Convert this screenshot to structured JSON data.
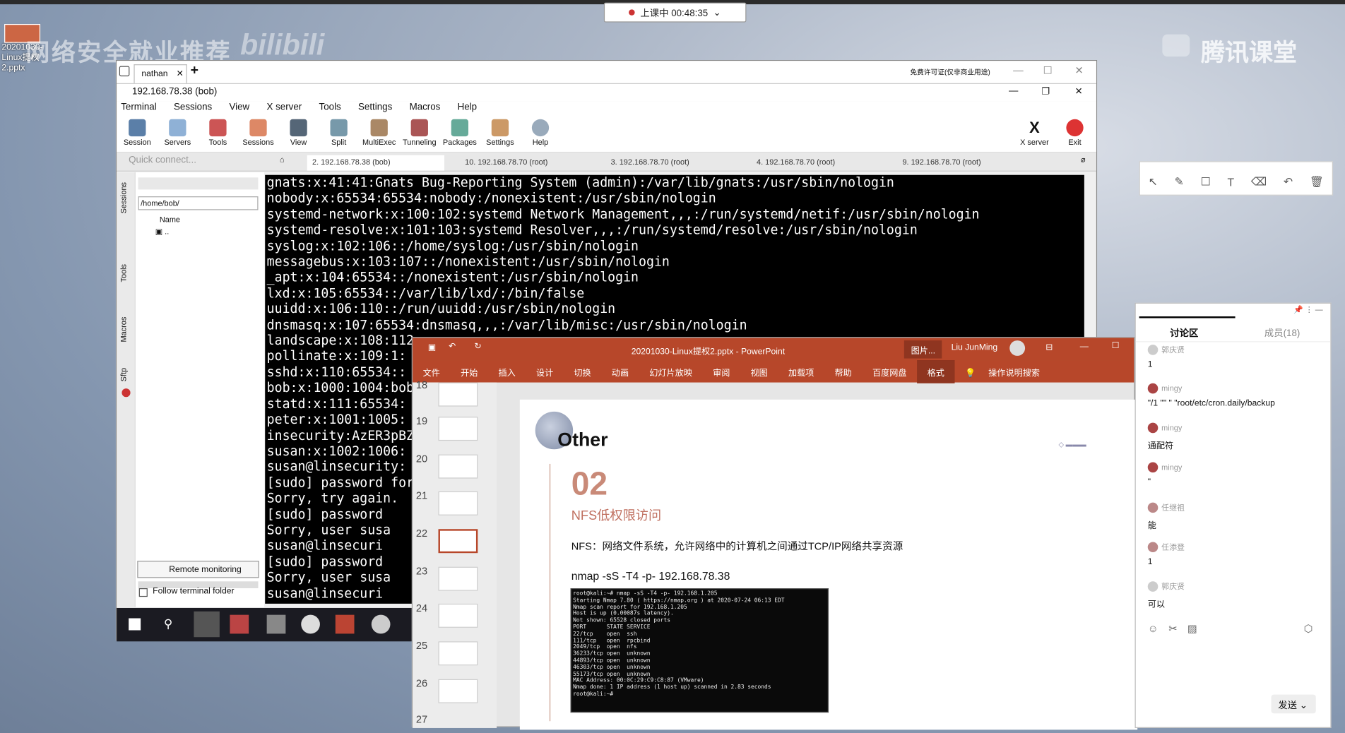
{
  "overlay": {
    "live_status": "上课中 00:48:35",
    "watermark": "网络安全就业推荐",
    "bilibili": "bilibili",
    "tencent": "腾讯课堂",
    "desktop_file": "20201030-Linux提权2.pptx"
  },
  "moba": {
    "tab_label": "nathan",
    "license_note": "免费许可证(仅非商业用途)",
    "window_title": "192.168.78.38 (bob)",
    "menu": [
      "Terminal",
      "Sessions",
      "View",
      "X server",
      "Tools",
      "Settings",
      "Macros",
      "Help"
    ],
    "toolbar": [
      "Session",
      "Servers",
      "Tools",
      "Sessions",
      "View",
      "Split",
      "MultiExec",
      "Tunneling",
      "Packages",
      "Settings",
      "Help",
      "X server",
      "Exit"
    ],
    "quick_connect": "Quick connect...",
    "session_tabs": [
      "2. 192.168.78.38 (bob)",
      "10. 192.168.78.70 (root)",
      "3. 192.168.78.70 (root)",
      "4. 192.168.78.70 (root)",
      "9. 192.168.78.70 (root)"
    ],
    "path": "/home/bob/",
    "tree_header": "Name",
    "tree_item": "..",
    "side_tabs": [
      "Sessions",
      "Tools",
      "Macros",
      "Sftp"
    ],
    "remote_monitoring": "Remote monitoring",
    "follow_terminal": "Follow terminal folder",
    "terminal_lines": [
      "gnats:x:41:41:Gnats Bug-Reporting System (admin):/var/lib/gnats:/usr/sbin/nologin",
      "nobody:x:65534:65534:nobody:/nonexistent:/usr/sbin/nologin",
      "systemd-network:x:100:102:systemd Network Management,,,:/run/systemd/netif:/usr/sbin/nologin",
      "systemd-resolve:x:101:103:systemd Resolver,,,:/run/systemd/resolve:/usr/sbin/nologin",
      "syslog:x:102:106::/home/syslog:/usr/sbin/nologin",
      "messagebus:x:103:107::/nonexistent:/usr/sbin/nologin",
      "_apt:x:104:65534::/nonexistent:/usr/sbin/nologin",
      "lxd:x:105:65534::/var/lib/lxd/:/bin/false",
      "uuidd:x:106:110::/run/uuidd:/usr/sbin/nologin",
      "dnsmasq:x:107:65534:dnsmasq,,,:/var/lib/misc:/usr/sbin/nologin",
      "landscape:x:108:112",
      "pollinate:x:109:1:",
      "sshd:x:110:65534::",
      "bob:x:1000:1004:bob",
      "statd:x:111:65534:",
      "peter:x:1001:1005:",
      "insecurity:AzER3pBZ",
      "susan:x:1002:1006:",
      "susan@linsecurity:",
      "[sudo] password for",
      "Sorry, try again.",
      "[sudo] password",
      "Sorry, user susa",
      "susan@linsecuri",
      "[sudo] password",
      "Sorry, user susa",
      "susan@linsecuri"
    ]
  },
  "ppt": {
    "title": "20201030-Linux提权2.pptx - PowerPoint",
    "search_label": "图片...",
    "user": "Liu JunMing",
    "tabs": [
      "文件",
      "开始",
      "插入",
      "设计",
      "切换",
      "动画",
      "幻灯片放映",
      "审阅",
      "视图",
      "加载项",
      "帮助",
      "百度网盘",
      "格式",
      "操作说明搜索"
    ],
    "slide_numbers": [
      "18",
      "19",
      "20",
      "21",
      "22",
      "23",
      "24",
      "25",
      "26",
      "27"
    ],
    "slide": {
      "heading": "Other",
      "number": "02",
      "subtitle": "NFS低权限访问",
      "desc": "NFS：网络文件系统，允许网络中的计算机之间通过TCP/IP网络共享资源",
      "command": "nmap -sS -T4 -p- 192.168.78.38",
      "nmap_lines": [
        "root@kali:~# nmap -sS -T4 -p- 192.168.1.205",
        "Starting Nmap 7.80 ( https://nmap.org ) at 2020-07-24 06:13 EDT",
        "Nmap scan report for 192.168.1.205",
        "Host is up (0.00087s latency).",
        "Not shown: 65528 closed ports",
        "PORT      STATE SERVICE",
        "22/tcp    open  ssh",
        "111/tcp   open  rpcbind",
        "2049/tcp  open  nfs",
        "36233/tcp open  unknown",
        "44893/tcp open  unknown",
        "46303/tcp open  unknown",
        "55173/tcp open  unknown",
        "MAC Address: 00:0C:29:C9:C8:87 (VMware)",
        "",
        "Nmap done: 1 IP address (1 host up) scanned in 2.83 seconds",
        "root@kali:~# "
      ]
    }
  },
  "chat": {
    "tab_discussion": "讨论区",
    "tab_members": "成员(18)",
    "send": "发送",
    "messages": [
      {
        "name": "郭庆贤",
        "text": "1"
      },
      {
        "name": "mingy",
        "text": "\"/1 \"\" \" \"root/etc/cron.daily/backup"
      },
      {
        "name": "mingy",
        "text": "通配符"
      },
      {
        "name": "mingy",
        "text": "\""
      },
      {
        "name": "任继祖",
        "text": "能"
      },
      {
        "name": "任添登",
        "text": "1"
      },
      {
        "name": "郭庆贤",
        "text": "可以"
      }
    ]
  },
  "colors": {
    "ppt_red": "#b7472a",
    "terminal_bg": "#000000"
  }
}
